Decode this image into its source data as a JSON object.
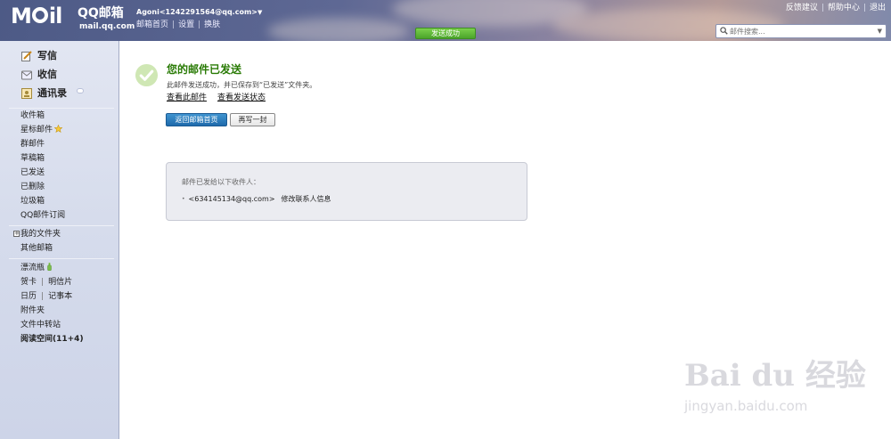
{
  "header": {
    "logo": {
      "brand": "MAIL",
      "product": "QQ邮箱",
      "domain": "mail.qq.com"
    },
    "account": {
      "display": "Agoni<1242291564@qq.com>",
      "caret": "▼"
    },
    "links": [
      {
        "label": "邮箱首页"
      },
      {
        "label": "设置"
      },
      {
        "label": "换肤"
      }
    ],
    "top_right": [
      {
        "label": "反馈建议"
      },
      {
        "label": "帮助中心"
      },
      {
        "label": "退出"
      }
    ],
    "search": {
      "placeholder": "邮件搜索..."
    },
    "toast": "发送成功"
  },
  "sidebar": {
    "primary": [
      {
        "label": "写信",
        "icon": "compose-icon"
      },
      {
        "label": "收信",
        "icon": "inbox-icon"
      },
      {
        "label": "通讯录",
        "icon": "contacts-icon"
      }
    ],
    "folders": [
      {
        "label": "收件箱"
      },
      {
        "label": "星标邮件"
      },
      {
        "label": "群邮件"
      },
      {
        "label": "草稿箱"
      },
      {
        "label": "已发送"
      },
      {
        "label": "已删除"
      },
      {
        "label": "垃圾箱"
      },
      {
        "label": "QQ邮件订阅"
      }
    ],
    "my_folders": {
      "label": "我的文件夹",
      "expander": "+"
    },
    "other_mailboxes": "其他邮箱",
    "apps": {
      "drift_bottle": "漂流瓶",
      "greeting_card": "贺卡",
      "postcard": "明信片",
      "calendar": "日历",
      "notepad": "记事本",
      "attachments": "附件夹",
      "file_transfer": "文件中转站",
      "reading_space": "阅读空间(11+4)",
      "separator": "|"
    }
  },
  "main": {
    "title": "您的邮件已发送",
    "description": "此邮件发送成功，并已保存到“已发送”文件夹。",
    "links": {
      "view_mail": "查看此邮件",
      "view_status": "查看发送状态"
    },
    "buttons": {
      "back_home": "返回邮箱首页",
      "write_again": "再写一封"
    },
    "recipients": {
      "heading": "邮件已发给以下收件人：",
      "list": [
        {
          "bullet": "•",
          "address": "<634145134@qq.com>",
          "action": "修改联系人信息"
        }
      ]
    }
  },
  "watermark": {
    "brand": "Bai du 经验",
    "url": "jingyan.baidu.com"
  },
  "colors": {
    "success_green": "#2a7b06",
    "toast_green": "#4ba42a",
    "primary_button": "#1f6aab",
    "header_bg": "#5e6894",
    "sidebar_bg": "#d6dcec"
  }
}
